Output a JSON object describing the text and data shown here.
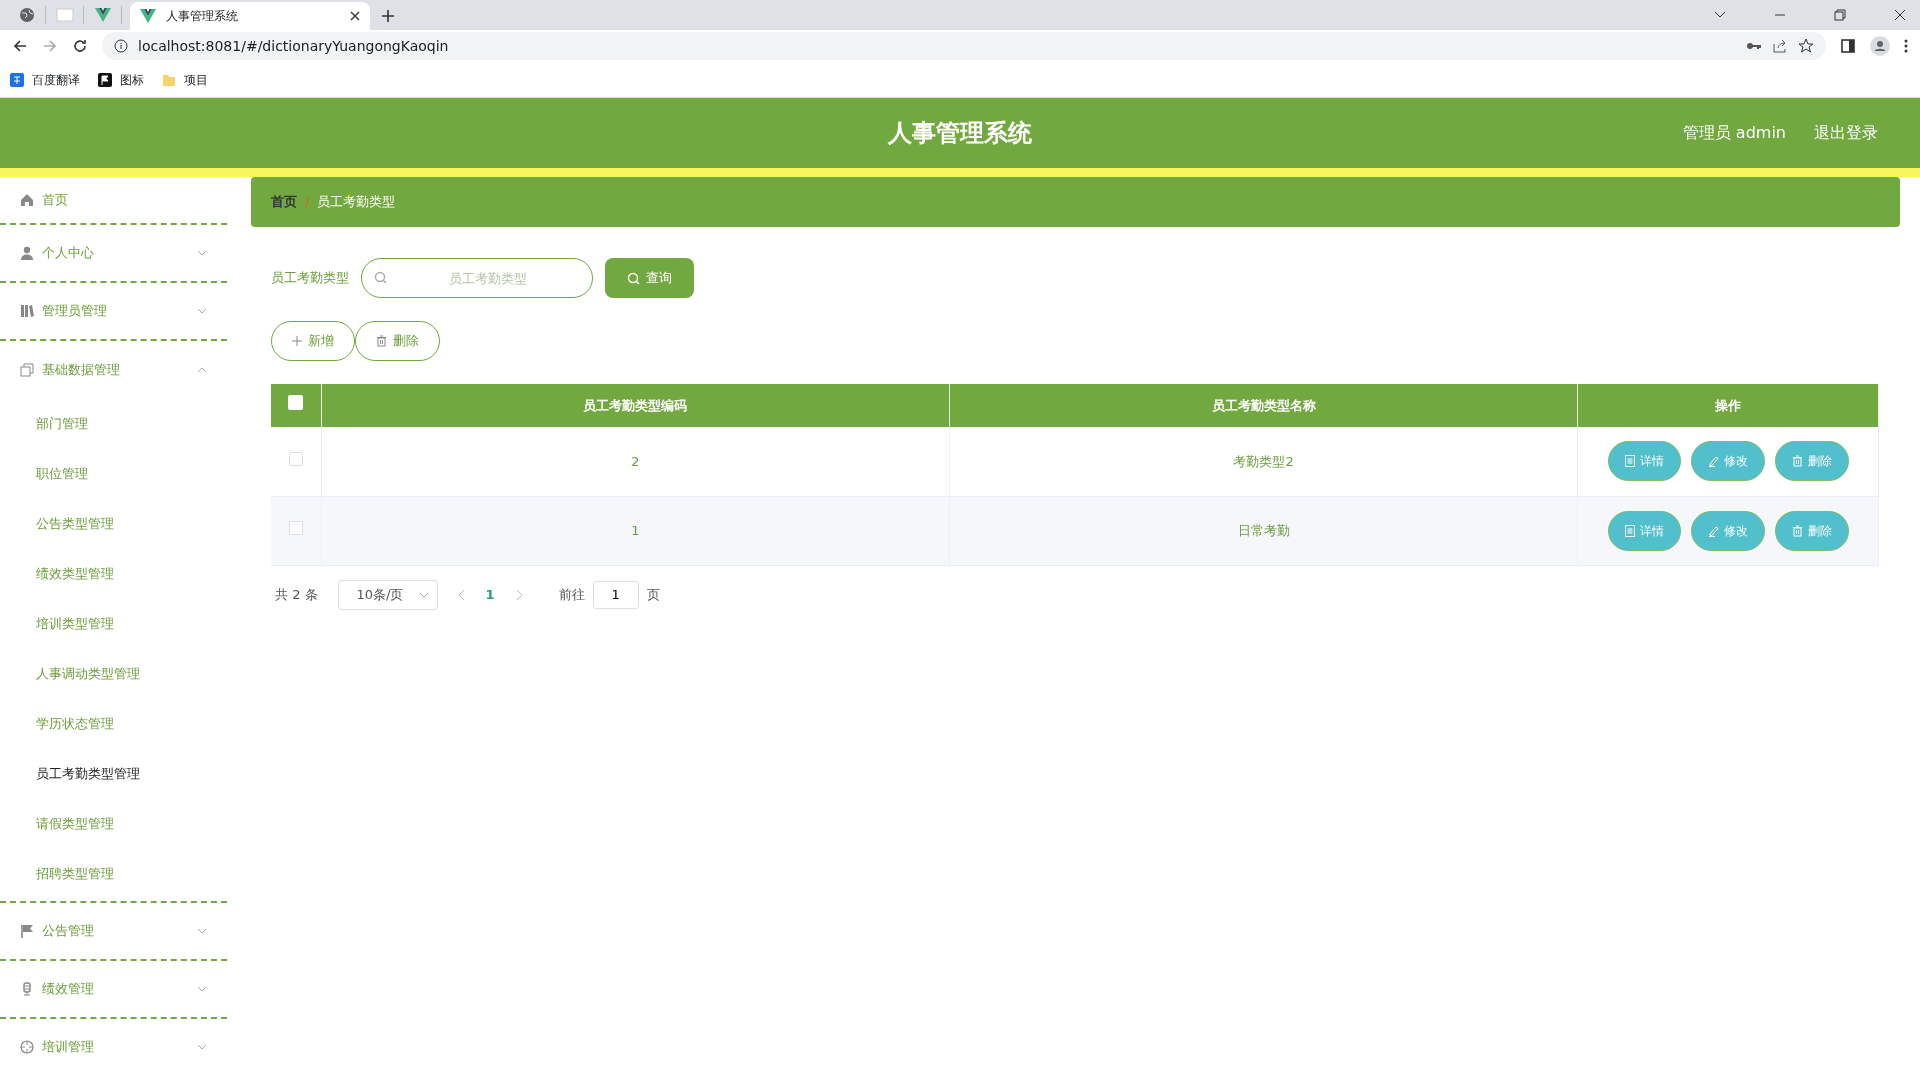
{
  "browser": {
    "tabs": [
      {
        "kind": "pinned",
        "selected": false
      },
      {
        "kind": "pinned",
        "selected": false
      },
      {
        "kind": "pinned",
        "selected": false
      },
      {
        "kind": "page",
        "title": "人事管理系统",
        "selected": true
      }
    ],
    "address": "localhost:8081/#/dictionaryYuangongKaoqin",
    "bookmarks": [
      "百度翻译",
      "图标",
      "项目"
    ]
  },
  "header": {
    "title": "人事管理系统",
    "user": "管理员 admin",
    "logout": "退出登录"
  },
  "sidebar": {
    "items": [
      {
        "kind": "link",
        "label": "首页"
      },
      {
        "kind": "group",
        "label": "个人中心",
        "expanded": false
      },
      {
        "kind": "group",
        "label": "管理员管理",
        "expanded": false
      },
      {
        "kind": "group",
        "label": "基础数据管理",
        "expanded": true,
        "children": [
          {
            "label": "部门管理",
            "selected": false
          },
          {
            "label": "职位管理",
            "selected": false
          },
          {
            "label": "公告类型管理",
            "selected": false
          },
          {
            "label": "绩效类型管理",
            "selected": false
          },
          {
            "label": "培训类型管理",
            "selected": false
          },
          {
            "label": "人事调动类型管理",
            "selected": false
          },
          {
            "label": "学历状态管理",
            "selected": false
          },
          {
            "label": "员工考勤类型管理",
            "selected": true
          },
          {
            "label": "请假类型管理",
            "selected": false
          },
          {
            "label": "招聘类型管理",
            "selected": false
          }
        ]
      },
      {
        "kind": "group",
        "label": "公告管理",
        "expanded": false
      },
      {
        "kind": "group",
        "label": "绩效管理",
        "expanded": false
      },
      {
        "kind": "group",
        "label": "培训管理",
        "expanded": false
      }
    ]
  },
  "breadcrumb": [
    "首页",
    "员工考勤类型"
  ],
  "breadcrumb_separator": "/",
  "search": {
    "label": "员工考勤类型",
    "placeholder": "员工考勤类型",
    "button": "查询"
  },
  "actions": [
    "新增",
    "删除"
  ],
  "table": {
    "all_checked": false,
    "columns": [
      "员工考勤类型编码",
      "员工考勤类型名称",
      "操作"
    ],
    "rows": [
      {
        "checked": false,
        "cells": [
          "2",
          "考勤类型2"
        ],
        "buttons": [
          "详情",
          "修改",
          "删除"
        ]
      },
      {
        "checked": false,
        "cells": [
          "1",
          "日常考勤"
        ],
        "buttons": [
          "详情",
          "修改",
          "删除"
        ]
      }
    ]
  },
  "pagination": {
    "total": "共 2 条",
    "page_size": "10条/页",
    "pages": [
      {
        "label": "1",
        "selected": true
      }
    ],
    "goto": "前往",
    "goto_value": "1",
    "page_unit": "页"
  }
}
